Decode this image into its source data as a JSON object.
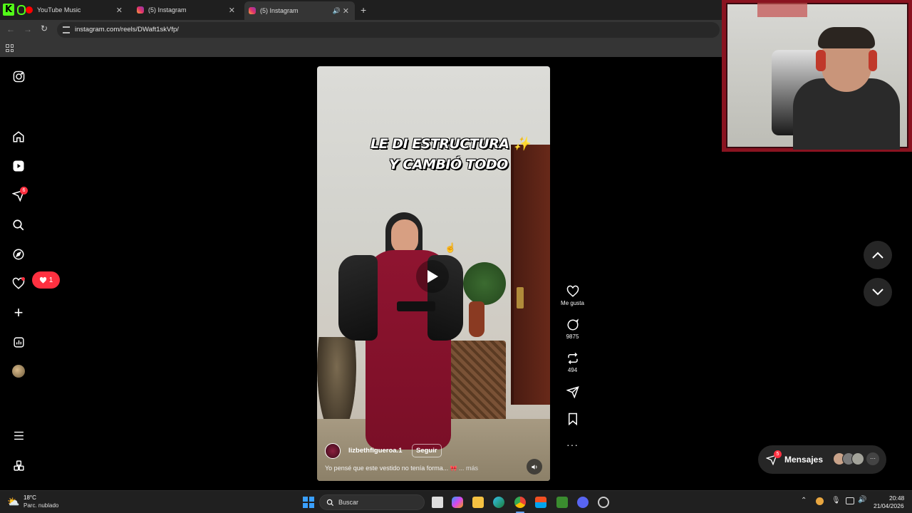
{
  "browser": {
    "tabs": [
      {
        "title": "YouTube Music",
        "active": false
      },
      {
        "title": "(5) Instagram",
        "active": false
      },
      {
        "title": "(5) Instagram",
        "active": true
      }
    ],
    "url": "instagram.com/reels/DWaft1skVfp/"
  },
  "sidebar": {
    "direct_badge": "6",
    "notification_popup_count": "1"
  },
  "reel": {
    "overlay_line1": "LE DI ESTRUCTURA",
    "overlay_line2": "Y CAMBIÓ TODO",
    "username": "lizbethfigueroa.1",
    "follow_label": "Seguir",
    "caption": "Yo pensé que este vestido no tenía forma...",
    "more_label": "... más"
  },
  "actions": {
    "like_label": "Me gusta",
    "comments_count": "9875",
    "reposts_count": "494"
  },
  "messages": {
    "label": "Mensajes",
    "badge": "5"
  },
  "taskbar": {
    "weather_temp": "18°C",
    "weather_desc": "Parc. nublado",
    "search_placeholder": "Buscar",
    "time": "20:48",
    "date": "21/04/2026"
  },
  "colors": {
    "accent_red": "#ff3040",
    "bg": "#000000",
    "chrome": "#353535"
  }
}
